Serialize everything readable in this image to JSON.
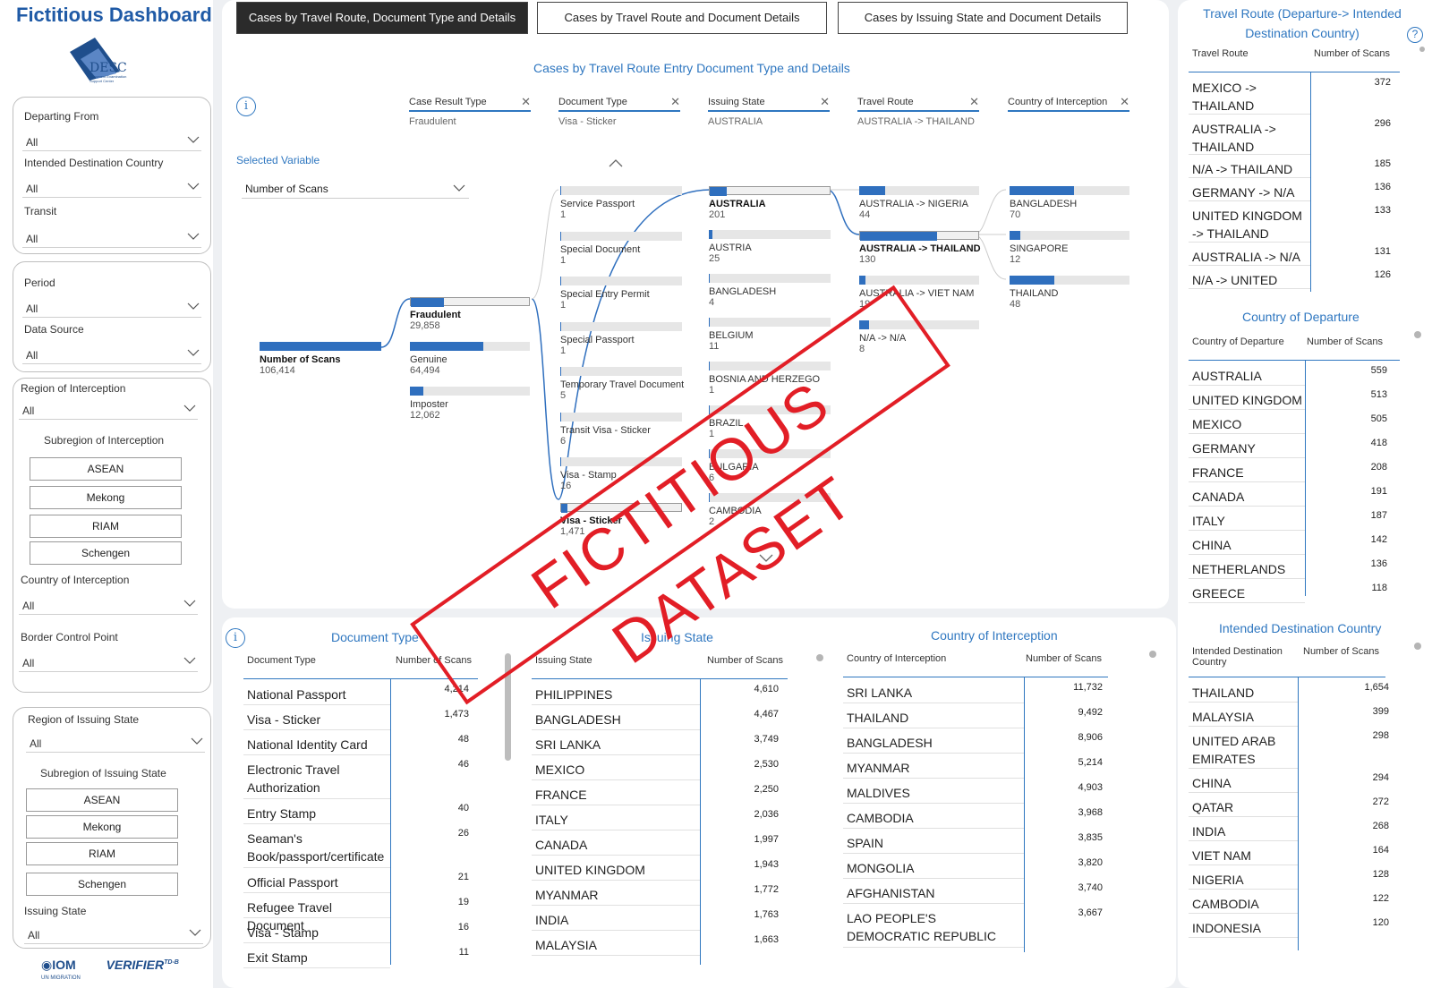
{
  "app": {
    "title": "Fictitious Dashboard",
    "logo_text": "DESC",
    "logo_sub1": "Document Examination",
    "logo_sub2": "Support Center"
  },
  "filters": {
    "departing_from": {
      "label": "Departing From",
      "value": "All"
    },
    "intended_destination": {
      "label": "Intended Destination Country",
      "value": "All"
    },
    "transit": {
      "label": "Transit",
      "value": "All"
    },
    "period": {
      "label": "Period",
      "value": "All"
    },
    "data_source": {
      "label": "Data Source",
      "value": "All"
    },
    "region_interception": {
      "label": "Region of Interception",
      "value": "All"
    },
    "subregion_interception": {
      "label": "Subregion of Interception",
      "buttons": [
        "ASEAN",
        "Mekong",
        "RIAM",
        "Schengen"
      ]
    },
    "country_interception": {
      "label": "Country of Interception",
      "value": "All"
    },
    "border_control_point": {
      "label": "Border Control Point",
      "value": "All"
    },
    "region_issuing": {
      "label": "Region of Issuing State",
      "value": "All"
    },
    "subregion_issuing": {
      "label": "Subregion of Issuing State",
      "buttons": [
        "ASEAN",
        "Mekong",
        "RIAM",
        "Schengen"
      ]
    },
    "issuing_state": {
      "label": "Issuing State",
      "value": "All"
    }
  },
  "footer": {
    "iom": "IOM",
    "iom_sub": "UN MIGRATION",
    "verifier": "VERIFIER",
    "verifier_sup": "TD-B"
  },
  "tabs": [
    {
      "label": "Cases by Travel Route, Document Type and Details",
      "active": true
    },
    {
      "label": "Cases by Travel Route and Document Details",
      "active": false
    },
    {
      "label": "Cases by Issuing State and Document Details",
      "active": false
    }
  ],
  "decomp": {
    "title": "Cases by Travel Route Entry Document Type and Details",
    "selected_variable_label": "Selected Variable",
    "selected_variable": "Number of Scans",
    "levels": [
      {
        "header": "Case Result Type",
        "value": "Fraudulent"
      },
      {
        "header": "Document Type",
        "value": "Visa - Sticker"
      },
      {
        "header": "Issuing State",
        "value": "AUSTRALIA"
      },
      {
        "header": "Travel Route",
        "value": "AUSTRALIA -> THAILAND"
      },
      {
        "header": "Country of Interception",
        "value": ""
      }
    ],
    "root": {
      "label": "Number of Scans",
      "value": "106,414",
      "fill": 1.0
    },
    "case_result": [
      {
        "label": "Fraudulent",
        "value": "29,858",
        "fill": 0.28,
        "selected": true
      },
      {
        "label": "Genuine",
        "value": "64,494",
        "fill": 0.61,
        "selected": false
      },
      {
        "label": "Imposter",
        "value": "12,062",
        "fill": 0.11,
        "selected": false
      }
    ],
    "document_type": [
      {
        "label": "Service Passport",
        "value": "1",
        "fill": 0.0
      },
      {
        "label": "Special Document",
        "value": "1",
        "fill": 0.0
      },
      {
        "label": "Special Entry Permit",
        "value": "1",
        "fill": 0.0
      },
      {
        "label": "Special Passport",
        "value": "1",
        "fill": 0.0
      },
      {
        "label": "Temporary Travel Document",
        "value": "5",
        "fill": 0.0
      },
      {
        "label": "Transit Visa - Sticker",
        "value": "6",
        "fill": 0.0
      },
      {
        "label": "Visa - Stamp",
        "value": "16",
        "fill": 0.0
      },
      {
        "label": "Visa - Sticker",
        "value": "1,471",
        "fill": 0.05,
        "selected": true
      }
    ],
    "issuing_state": [
      {
        "label": "AUSTRALIA",
        "value": "201",
        "fill": 0.14,
        "selected": true
      },
      {
        "label": "AUSTRIA",
        "value": "25",
        "fill": 0.02
      },
      {
        "label": "BANGLADESH",
        "value": "4",
        "fill": 0.0
      },
      {
        "label": "BELGIUM",
        "value": "11",
        "fill": 0.0
      },
      {
        "label": "BOSNIA AND HERZEGO",
        "value": "1",
        "fill": 0.0
      },
      {
        "label": "BRAZIL",
        "value": "1",
        "fill": 0.0
      },
      {
        "label": "BULGARIA",
        "value": "6",
        "fill": 0.0
      },
      {
        "label": "CAMBODIA",
        "value": "2",
        "fill": 0.0
      }
    ],
    "travel_route": [
      {
        "label": "AUSTRALIA -> NIGERIA",
        "value": "44",
        "fill": 0.22
      },
      {
        "label": "AUSTRALIA -> THAILAND",
        "value": "130",
        "fill": 0.65,
        "selected": true
      },
      {
        "label": "AUSTRALIA -> VIET NAM",
        "value": "19",
        "fill": 0.05
      },
      {
        "label": "N/A -> N/A",
        "value": "8",
        "fill": 0.08
      }
    ],
    "country_interception": [
      {
        "label": "BANGLADESH",
        "value": "70",
        "fill": 0.54
      },
      {
        "label": "SINGAPORE",
        "value": "12",
        "fill": 0.09
      },
      {
        "label": "THAILAND",
        "value": "48",
        "fill": 0.37
      }
    ]
  },
  "doc_type_table": {
    "title": "Document Type",
    "col1": "Document Type",
    "col2": "Number of Scans",
    "rows": [
      {
        "name": "National Passport",
        "count": "4,214"
      },
      {
        "name": "Visa - Sticker",
        "count": "1,473"
      },
      {
        "name": "National Identity Card",
        "count": "48"
      },
      {
        "name": "Electronic Travel Authorization",
        "count": "46"
      },
      {
        "name": "Entry Stamp",
        "count": "40"
      },
      {
        "name": "Seaman's Book/passport/certificate",
        "count": "26"
      },
      {
        "name": "Official Passport",
        "count": "21"
      },
      {
        "name": "Refugee Travel Document",
        "count": "19"
      },
      {
        "name": "Visa - Stamp",
        "count": "16"
      },
      {
        "name": "Exit Stamp",
        "count": "11"
      }
    ]
  },
  "issuing_state_table": {
    "title": "Issuing State",
    "col1": "Issuing State",
    "col2": "Number of Scans",
    "rows": [
      {
        "name": "PHILIPPINES",
        "count": "4,610"
      },
      {
        "name": "BANGLADESH",
        "count": "4,467"
      },
      {
        "name": "SRI LANKA",
        "count": "3,749"
      },
      {
        "name": "MEXICO",
        "count": "2,530"
      },
      {
        "name": "FRANCE",
        "count": "2,250"
      },
      {
        "name": "ITALY",
        "count": "2,036"
      },
      {
        "name": "CANADA",
        "count": "1,997"
      },
      {
        "name": "UNITED KINGDOM",
        "count": "1,943"
      },
      {
        "name": "MYANMAR",
        "count": "1,772"
      },
      {
        "name": "INDIA",
        "count": "1,763"
      },
      {
        "name": "MALAYSIA",
        "count": "1,663"
      }
    ]
  },
  "interception_table": {
    "title": "Country of Interception",
    "col1": "Country of Interception",
    "col2": "Number of Scans",
    "rows": [
      {
        "name": "SRI LANKA",
        "count": "11,732"
      },
      {
        "name": "THAILAND",
        "count": "9,492"
      },
      {
        "name": "BANGLADESH",
        "count": "8,906"
      },
      {
        "name": "MYANMAR",
        "count": "5,214"
      },
      {
        "name": "MALDIVES",
        "count": "4,903"
      },
      {
        "name": "CAMBODIA",
        "count": "3,968"
      },
      {
        "name": "SPAIN",
        "count": "3,835"
      },
      {
        "name": "MONGOLIA",
        "count": "3,820"
      },
      {
        "name": "AFGHANISTAN",
        "count": "3,740"
      },
      {
        "name": "LAO PEOPLE'S DEMOCRATIC REPUBLIC",
        "count": "3,667"
      }
    ]
  },
  "travel_route_table": {
    "title": "Travel Route (Departure-> Intended Destination Country)",
    "col1": "Travel Route",
    "col2": "Number of Scans",
    "rows": [
      {
        "name": "MEXICO -> THAILAND",
        "count": "372"
      },
      {
        "name": "AUSTRALIA -> THAILAND",
        "count": "296"
      },
      {
        "name": "N/A -> THAILAND",
        "count": "185"
      },
      {
        "name": "GERMANY -> N/A",
        "count": "136"
      },
      {
        "name": "UNITED KINGDOM -> THAILAND",
        "count": "133"
      },
      {
        "name": "AUSTRALIA -> N/A",
        "count": "131"
      },
      {
        "name": "N/A -> UNITED",
        "count": "126"
      }
    ]
  },
  "departure_table": {
    "title": "Country of Departure",
    "col1": "Country of Departure",
    "col2": "Number of Scans",
    "rows": [
      {
        "name": "AUSTRALIA",
        "count": "559"
      },
      {
        "name": "UNITED KINGDOM",
        "count": "513"
      },
      {
        "name": "MEXICO",
        "count": "505"
      },
      {
        "name": "GERMANY",
        "count": "418"
      },
      {
        "name": "FRANCE",
        "count": "208"
      },
      {
        "name": "CANADA",
        "count": "191"
      },
      {
        "name": "ITALY",
        "count": "187"
      },
      {
        "name": "CHINA",
        "count": "142"
      },
      {
        "name": "NETHERLANDS",
        "count": "136"
      },
      {
        "name": "GREECE",
        "count": "118"
      }
    ]
  },
  "destination_table": {
    "title": "Intended Destination Country",
    "col1": "Intended Destination Country",
    "col2": "Number of Scans",
    "rows": [
      {
        "name": "THAILAND",
        "count": "1,654"
      },
      {
        "name": "MALAYSIA",
        "count": "399"
      },
      {
        "name": "UNITED ARAB EMIRATES",
        "count": "298"
      },
      {
        "name": "CHINA",
        "count": "294"
      },
      {
        "name": "QATAR",
        "count": "272"
      },
      {
        "name": "INDIA",
        "count": "268"
      },
      {
        "name": "VIET NAM",
        "count": "164"
      },
      {
        "name": "NIGERIA",
        "count": "128"
      },
      {
        "name": "CAMBODIA",
        "count": "122"
      },
      {
        "name": "INDONESIA",
        "count": "120"
      }
    ]
  },
  "watermark": {
    "text": "FICTITIOUS DATASET"
  },
  "colors": {
    "accent": "#2f77c0",
    "bar": "#2f6fbe",
    "stamp": "#e21e26",
    "title": "#1f5aa6"
  }
}
